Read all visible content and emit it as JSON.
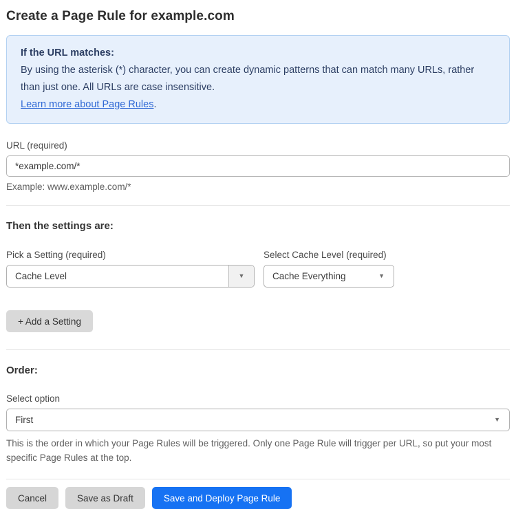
{
  "page": {
    "title": "Create a Page Rule for example.com"
  },
  "info_box": {
    "heading": "If the URL matches:",
    "body": "By using the asterisk (*) character, you can create dynamic patterns that can match many URLs, rather than just one. All URLs are case insensitive.",
    "link_label": "Learn more about Page Rules",
    "link_suffix": "."
  },
  "url_field": {
    "label": "URL (required)",
    "value": "*example.com/*",
    "helper": "Example: www.example.com/*"
  },
  "settings_section": {
    "heading": "Then the settings are:",
    "setting_picker": {
      "label": "Pick a Setting (required)",
      "value": "Cache Level"
    },
    "cache_level_picker": {
      "label": "Select Cache Level (required)",
      "value": "Cache Everything"
    },
    "add_setting_label": "+ Add a Setting"
  },
  "order_section": {
    "heading": "Order:",
    "label": "Select option",
    "value": "First",
    "helper": "This is the order in which your Page Rules will be triggered. Only one Page Rule will trigger per URL, so put your most specific Page Rules at the top."
  },
  "actions": {
    "cancel": "Cancel",
    "save_draft": "Save as Draft",
    "save_deploy": "Save and Deploy Page Rule"
  },
  "icons": {
    "dropdown_arrow": "▼"
  },
  "colors": {
    "accent_blue": "#1672f3",
    "info_background": "#e7f0fc",
    "info_border": "#b3d1f2",
    "info_text": "#2c3e63",
    "link_blue": "#3069d5"
  }
}
